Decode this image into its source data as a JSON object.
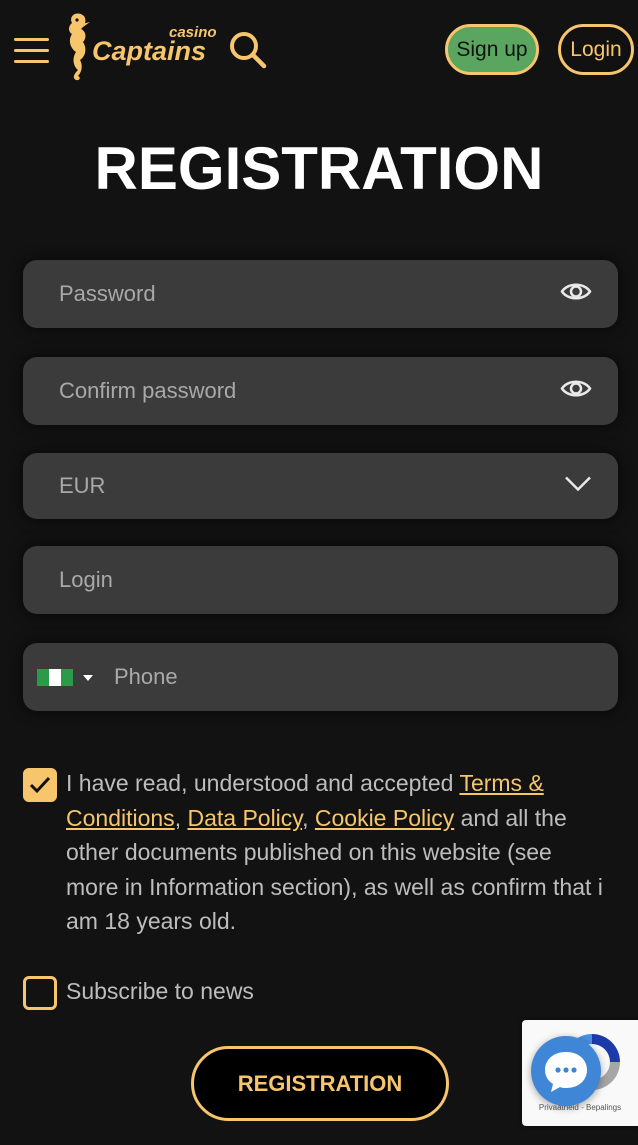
{
  "header": {
    "logo_main": "Captains",
    "logo_sub": "casino",
    "signup_label": "Sign up",
    "login_label": "Login"
  },
  "page_title": "REGISTRATION",
  "form": {
    "password_placeholder": "Password",
    "confirm_password_placeholder": "Confirm password",
    "currency_value": "EUR",
    "login_placeholder": "Login",
    "phone_placeholder": "Phone",
    "phone_country_flag": "nigeria-flag"
  },
  "terms": {
    "checked": true,
    "text_before": "I have read, understood and accepted ",
    "link_terms": "Terms & Conditions",
    "sep1": ", ",
    "link_data_policy": "Data Policy",
    "sep2": ", ",
    "link_cookie_policy": "Cookie Policy",
    "text_after": " and all the other documents published on this website (see more in Information section), as well as confirm that i am 18 years old."
  },
  "subscribe": {
    "checked": false,
    "label": "Subscribe to news"
  },
  "submit_label": "REGISTRATION",
  "recaptcha": {
    "legal": "Privaatheid - Bepalings"
  },
  "colors": {
    "accent": "#f6c56c",
    "background": "#121212",
    "field": "#3b3b3b",
    "signup_bg": "#5aa55f",
    "chat_bubble": "#3f86d6"
  }
}
